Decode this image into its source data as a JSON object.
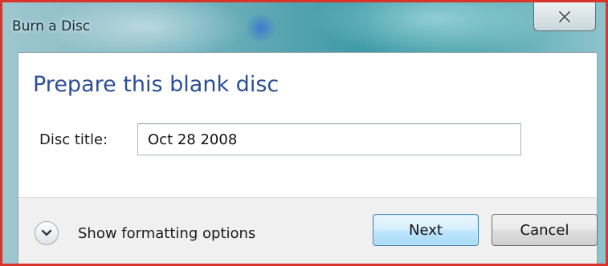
{
  "window": {
    "title": "Burn a Disc",
    "close_glyph": "X",
    "close_icon": "close-icon"
  },
  "dialog": {
    "heading": "Prepare this blank disc",
    "disc_title_label": "Disc title:",
    "disc_title_value": "Oct 28 2008"
  },
  "footer": {
    "toggle_icon": "chevron-down-icon",
    "toggle_label": "Show formatting options",
    "next_label": "Next",
    "cancel_label": "Cancel"
  },
  "colors": {
    "heading": "#2b4f98",
    "window_border": "#d9342a",
    "next_button_border": "#3c7fb1"
  }
}
